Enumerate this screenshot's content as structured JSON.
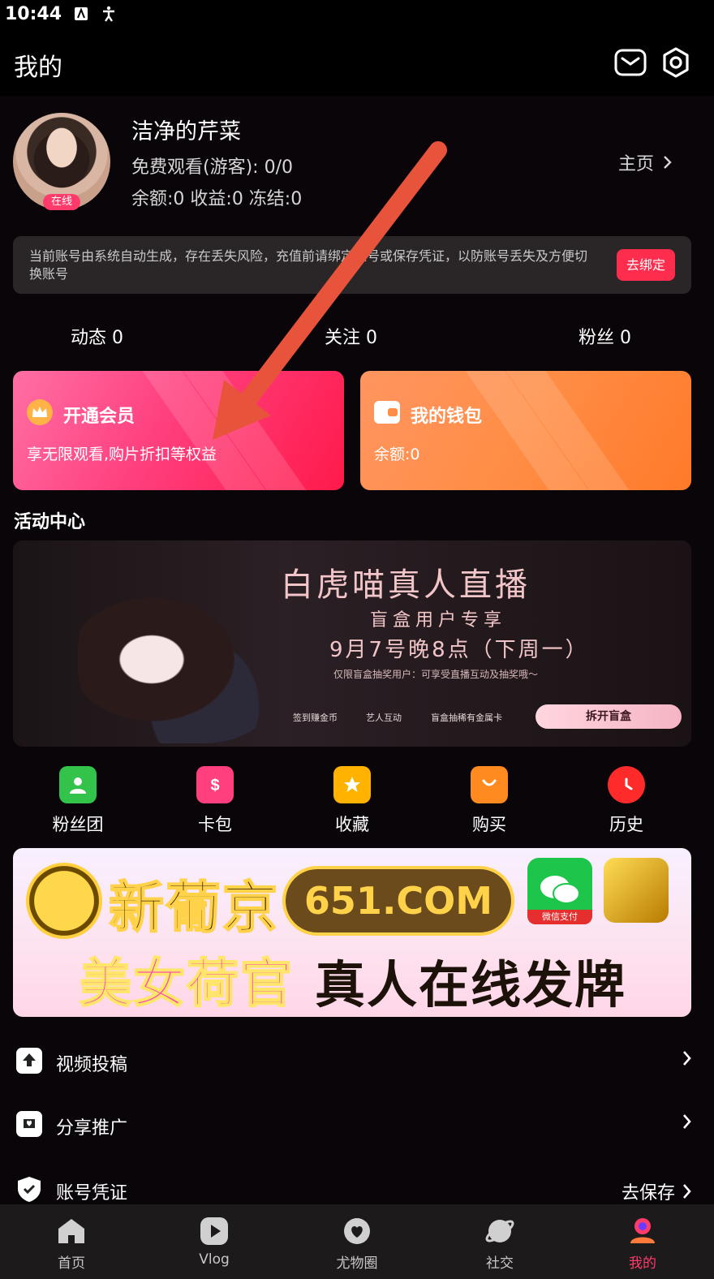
{
  "status_bar": {
    "time": "10:44"
  },
  "header": {
    "title": "我的"
  },
  "profile": {
    "name": "洁净的芹菜",
    "online_badge": "在线",
    "free_watch": "免费观看(游客): 0/0",
    "balance_line": "余额:0 收益:0 冻结:0",
    "homepage_link": "主页"
  },
  "notice": {
    "text": "当前账号由系统自动生成，存在丢失风险，充值前请绑定账号或保存凭证，以防账号丢失及方便切换账号",
    "bind_button": "去绑定"
  },
  "stats": [
    {
      "label": "动态",
      "count": "0"
    },
    {
      "label": "关注",
      "count": "0"
    },
    {
      "label": "粉丝",
      "count": "0"
    }
  ],
  "cards": {
    "vip": {
      "title": "开通会员",
      "subtitle": "享无限观看,购片折扣等权益"
    },
    "wallet": {
      "title": "我的钱包",
      "subtitle": "余额:0"
    }
  },
  "activity": {
    "section_title": "活动中心",
    "banner": {
      "headline": "白虎喵真人直播",
      "sub": "盲盒用户专享",
      "date": "9月7号晚8点（下周一）",
      "note": "仅限盲盒抽奖用户：可享受直播互动及抽奖哦～",
      "features": [
        "签到赚金币",
        "艺人互动",
        "盲盒抽稀有金属卡"
      ],
      "cta": "拆开盲盒"
    }
  },
  "quick_actions": [
    {
      "label": "粉丝团",
      "color": "#33c24a",
      "icon": "user-icon"
    },
    {
      "label": "卡包",
      "color": "#ff3f7e",
      "icon": "coupon-icon"
    },
    {
      "label": "收藏",
      "color": "#ffb300",
      "icon": "star-icon"
    },
    {
      "label": "购买",
      "color": "#ff8a1f",
      "icon": "bag-icon"
    },
    {
      "label": "历史",
      "color": "#ff2a2a",
      "icon": "clock-icon"
    }
  ],
  "ad_banner": {
    "brand": "新葡京",
    "domain": "651.COM",
    "wechat_label": "微信支付",
    "slogan_1": "美女荷官",
    "slogan_2": "真人在线发牌"
  },
  "menu": [
    {
      "label": "视频投稿",
      "right": ""
    },
    {
      "label": "分享推广",
      "right": ""
    },
    {
      "label": "账号凭证",
      "right": "去保存"
    }
  ],
  "bottom_nav": [
    {
      "label": "首页",
      "active": false
    },
    {
      "label": "Vlog",
      "active": false
    },
    {
      "label": "尤物圈",
      "active": false
    },
    {
      "label": "社交",
      "active": false
    },
    {
      "label": "我的",
      "active": true
    }
  ],
  "colors": {
    "accent": "#ff3b6b",
    "arrow": "#e8533b"
  }
}
